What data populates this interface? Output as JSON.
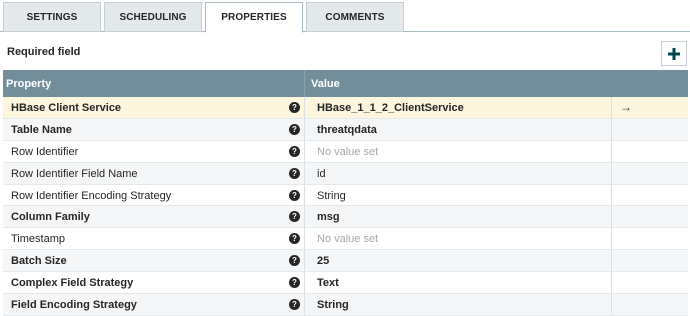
{
  "tabs": [
    {
      "label": "SETTINGS",
      "active": false
    },
    {
      "label": "SCHEDULING",
      "active": false
    },
    {
      "label": "PROPERTIES",
      "active": true
    },
    {
      "label": "COMMENTS",
      "active": false
    }
  ],
  "required_label": "Required field",
  "add_icon": "plus-icon",
  "table": {
    "headers": {
      "property": "Property",
      "value": "Value"
    },
    "rows": [
      {
        "name": "HBase Client Service",
        "value": "HBase_1_1_2_ClientService",
        "required": true,
        "empty": false,
        "highlighted": true,
        "goto": "→"
      },
      {
        "name": "Table Name",
        "value": "threatqdata",
        "required": true,
        "empty": false
      },
      {
        "name": "Row Identifier",
        "value": "No value set",
        "required": false,
        "empty": true
      },
      {
        "name": "Row Identifier Field Name",
        "value": "id",
        "required": false,
        "empty": false
      },
      {
        "name": "Row Identifier Encoding Strategy",
        "value": "String",
        "required": false,
        "empty": false
      },
      {
        "name": "Column Family",
        "value": "msg",
        "required": true,
        "empty": false
      },
      {
        "name": "Timestamp",
        "value": "No value set",
        "required": false,
        "empty": true
      },
      {
        "name": "Batch Size",
        "value": "25",
        "required": true,
        "empty": false
      },
      {
        "name": "Complex Field Strategy",
        "value": "Text",
        "required": true,
        "empty": false
      },
      {
        "name": "Field Encoding Strategy",
        "value": "String",
        "required": true,
        "empty": false
      }
    ],
    "help_icon": "question-circle-icon",
    "help_glyph": "?"
  },
  "colors": {
    "header_bg": "#728e9b",
    "highlight_row": "#fcf6de",
    "alt_row": "#f4f6f7"
  }
}
